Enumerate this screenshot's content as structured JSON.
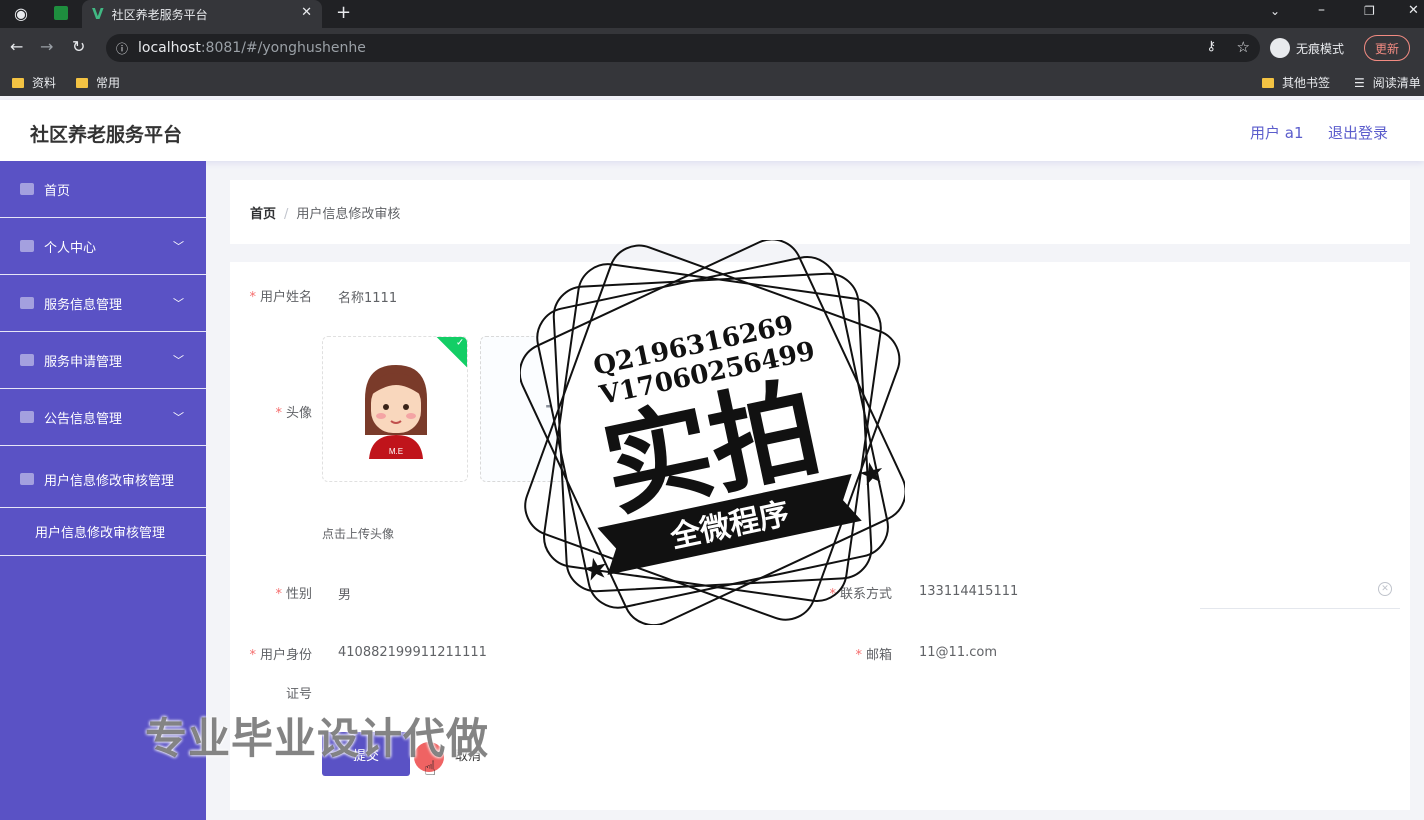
{
  "browser": {
    "tab_title": "社区养老服务平台",
    "url_host": "localhost",
    "url_path": ":8081/#/yonghushenhe",
    "incognito_label": "无痕模式",
    "update_label": "更新",
    "bookmarks": [
      "资料",
      "常用"
    ],
    "bookmarks_right": [
      "其他书签",
      "阅读清单"
    ]
  },
  "header": {
    "brand": "社区养老服务平台",
    "user": "用户 a1",
    "logout": "退出登录"
  },
  "sidebar": {
    "items": [
      {
        "label": "首页"
      },
      {
        "label": "个人中心"
      },
      {
        "label": "服务信息管理"
      },
      {
        "label": "服务申请管理"
      },
      {
        "label": "公告信息管理"
      },
      {
        "label": "用户信息修改审核管理"
      }
    ],
    "submenu": "用户信息修改审核管理"
  },
  "breadcrumb": {
    "home": "首页",
    "separator": "/",
    "current": "用户信息修改审核"
  },
  "form": {
    "name_label": "用户姓名",
    "name_value": "名称1111",
    "avatar_label": "头像",
    "upload_hint": "点击上传头像",
    "gender_label": "性别",
    "gender_value": "男",
    "contact_label": "联系方式",
    "contact_value": "133114415111",
    "idcard_label_1": "用户身份",
    "idcard_label_2": "证号",
    "idcard_value": "410882199911211111",
    "email_label": "邮箱",
    "email_value": "11@11.com",
    "submit": "提交",
    "cancel": "取消",
    "required_mark": "*"
  },
  "watermark": {
    "line1": "Q2196316269",
    "line2": "V17060256499",
    "big": "实拍",
    "ribbon": "全微程序",
    "caption": "专业毕业设计代做"
  },
  "avatar_badge": "M.E"
}
